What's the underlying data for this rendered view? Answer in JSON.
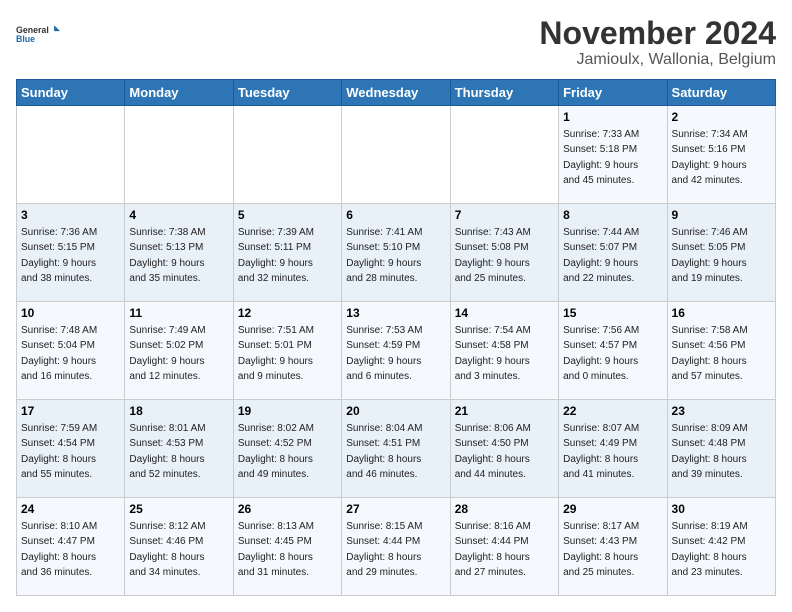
{
  "logo": {
    "line1": "General",
    "line2": "Blue"
  },
  "title": "November 2024",
  "subtitle": "Jamioulx, Wallonia, Belgium",
  "days_header": [
    "Sunday",
    "Monday",
    "Tuesday",
    "Wednesday",
    "Thursday",
    "Friday",
    "Saturday"
  ],
  "weeks": [
    [
      {
        "day": "",
        "info": ""
      },
      {
        "day": "",
        "info": ""
      },
      {
        "day": "",
        "info": ""
      },
      {
        "day": "",
        "info": ""
      },
      {
        "day": "",
        "info": ""
      },
      {
        "day": "1",
        "info": "Sunrise: 7:33 AM\nSunset: 5:18 PM\nDaylight: 9 hours\nand 45 minutes."
      },
      {
        "day": "2",
        "info": "Sunrise: 7:34 AM\nSunset: 5:16 PM\nDaylight: 9 hours\nand 42 minutes."
      }
    ],
    [
      {
        "day": "3",
        "info": "Sunrise: 7:36 AM\nSunset: 5:15 PM\nDaylight: 9 hours\nand 38 minutes."
      },
      {
        "day": "4",
        "info": "Sunrise: 7:38 AM\nSunset: 5:13 PM\nDaylight: 9 hours\nand 35 minutes."
      },
      {
        "day": "5",
        "info": "Sunrise: 7:39 AM\nSunset: 5:11 PM\nDaylight: 9 hours\nand 32 minutes."
      },
      {
        "day": "6",
        "info": "Sunrise: 7:41 AM\nSunset: 5:10 PM\nDaylight: 9 hours\nand 28 minutes."
      },
      {
        "day": "7",
        "info": "Sunrise: 7:43 AM\nSunset: 5:08 PM\nDaylight: 9 hours\nand 25 minutes."
      },
      {
        "day": "8",
        "info": "Sunrise: 7:44 AM\nSunset: 5:07 PM\nDaylight: 9 hours\nand 22 minutes."
      },
      {
        "day": "9",
        "info": "Sunrise: 7:46 AM\nSunset: 5:05 PM\nDaylight: 9 hours\nand 19 minutes."
      }
    ],
    [
      {
        "day": "10",
        "info": "Sunrise: 7:48 AM\nSunset: 5:04 PM\nDaylight: 9 hours\nand 16 minutes."
      },
      {
        "day": "11",
        "info": "Sunrise: 7:49 AM\nSunset: 5:02 PM\nDaylight: 9 hours\nand 12 minutes."
      },
      {
        "day": "12",
        "info": "Sunrise: 7:51 AM\nSunset: 5:01 PM\nDaylight: 9 hours\nand 9 minutes."
      },
      {
        "day": "13",
        "info": "Sunrise: 7:53 AM\nSunset: 4:59 PM\nDaylight: 9 hours\nand 6 minutes."
      },
      {
        "day": "14",
        "info": "Sunrise: 7:54 AM\nSunset: 4:58 PM\nDaylight: 9 hours\nand 3 minutes."
      },
      {
        "day": "15",
        "info": "Sunrise: 7:56 AM\nSunset: 4:57 PM\nDaylight: 9 hours\nand 0 minutes."
      },
      {
        "day": "16",
        "info": "Sunrise: 7:58 AM\nSunset: 4:56 PM\nDaylight: 8 hours\nand 57 minutes."
      }
    ],
    [
      {
        "day": "17",
        "info": "Sunrise: 7:59 AM\nSunset: 4:54 PM\nDaylight: 8 hours\nand 55 minutes."
      },
      {
        "day": "18",
        "info": "Sunrise: 8:01 AM\nSunset: 4:53 PM\nDaylight: 8 hours\nand 52 minutes."
      },
      {
        "day": "19",
        "info": "Sunrise: 8:02 AM\nSunset: 4:52 PM\nDaylight: 8 hours\nand 49 minutes."
      },
      {
        "day": "20",
        "info": "Sunrise: 8:04 AM\nSunset: 4:51 PM\nDaylight: 8 hours\nand 46 minutes."
      },
      {
        "day": "21",
        "info": "Sunrise: 8:06 AM\nSunset: 4:50 PM\nDaylight: 8 hours\nand 44 minutes."
      },
      {
        "day": "22",
        "info": "Sunrise: 8:07 AM\nSunset: 4:49 PM\nDaylight: 8 hours\nand 41 minutes."
      },
      {
        "day": "23",
        "info": "Sunrise: 8:09 AM\nSunset: 4:48 PM\nDaylight: 8 hours\nand 39 minutes."
      }
    ],
    [
      {
        "day": "24",
        "info": "Sunrise: 8:10 AM\nSunset: 4:47 PM\nDaylight: 8 hours\nand 36 minutes."
      },
      {
        "day": "25",
        "info": "Sunrise: 8:12 AM\nSunset: 4:46 PM\nDaylight: 8 hours\nand 34 minutes."
      },
      {
        "day": "26",
        "info": "Sunrise: 8:13 AM\nSunset: 4:45 PM\nDaylight: 8 hours\nand 31 minutes."
      },
      {
        "day": "27",
        "info": "Sunrise: 8:15 AM\nSunset: 4:44 PM\nDaylight: 8 hours\nand 29 minutes."
      },
      {
        "day": "28",
        "info": "Sunrise: 8:16 AM\nSunset: 4:44 PM\nDaylight: 8 hours\nand 27 minutes."
      },
      {
        "day": "29",
        "info": "Sunrise: 8:17 AM\nSunset: 4:43 PM\nDaylight: 8 hours\nand 25 minutes."
      },
      {
        "day": "30",
        "info": "Sunrise: 8:19 AM\nSunset: 4:42 PM\nDaylight: 8 hours\nand 23 minutes."
      }
    ]
  ]
}
